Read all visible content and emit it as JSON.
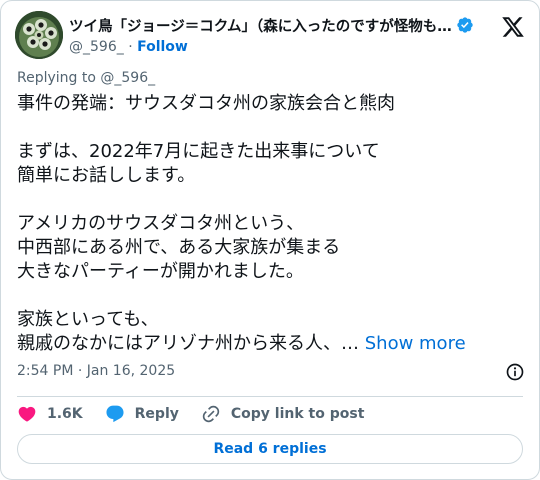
{
  "author": {
    "display_name": "ツイ鳥「ジョージ＝コクム」（森に入ったのですが怪物も…",
    "handle": "@_596_",
    "separator": "·",
    "follow_label": "Follow"
  },
  "reply_to": "Replying to @_596_",
  "tweet": {
    "lines": [
      "事件の発端：サウスダコタ州の家族会合と熊肉",
      "",
      "まずは、2022年7月に起きた出来事について",
      "簡単にお話しします。",
      "",
      "アメリカのサウスダコタ州という、",
      "中西部にある州で、ある大家族が集まる",
      "大きなパーティーが開かれました。",
      "",
      "家族といっても、",
      "親戚のなかにはアリゾナ州から来る人、… "
    ],
    "show_more": "Show more"
  },
  "timestamp": "2:54 PM · Jan 16, 2025",
  "actions": {
    "like_count": "1.6K",
    "reply_label": "Reply",
    "copy_link_label": "Copy link to post"
  },
  "read_replies_label": "Read 6 replies",
  "colors": {
    "accent": "#006fd6",
    "like": "#f91880",
    "verified": "#1d9bf0",
    "muted": "#536471",
    "text": "#0f1419",
    "border": "#cfd9de"
  },
  "icons": [
    "avatar-image",
    "verified-badge-icon",
    "x-logo-icon",
    "info-icon",
    "heart-icon",
    "reply-bubble-icon",
    "link-icon"
  ]
}
